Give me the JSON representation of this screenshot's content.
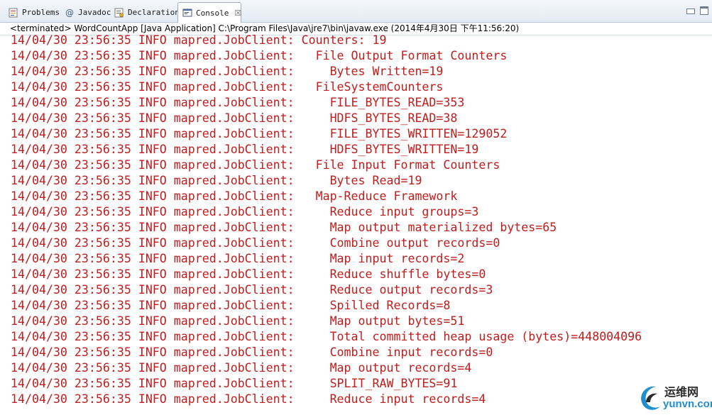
{
  "tabs": [
    {
      "label": "Problems",
      "icon": "problems-icon",
      "active": false
    },
    {
      "label": "Javadoc",
      "icon": "javadoc-at-icon",
      "active": false
    },
    {
      "label": "Declaration",
      "icon": "declaration-icon",
      "active": false
    },
    {
      "label": "Console",
      "icon": "console-icon",
      "active": true,
      "close": "☒"
    }
  ],
  "process_line": "<terminated> WordCountApp [Java Application] C:\\Program Files\\Java\\jre7\\bin\\javaw.exe (2014年4月30日 下午11:56:20)",
  "console_color": "#c01d1d",
  "console_lines": [
    "14/04/30 23:56:35 INFO mapred.JobClient: Counters: 19",
    "14/04/30 23:56:35 INFO mapred.JobClient:   File Output Format Counters",
    "14/04/30 23:56:35 INFO mapred.JobClient:     Bytes Written=19",
    "14/04/30 23:56:35 INFO mapred.JobClient:   FileSystemCounters",
    "14/04/30 23:56:35 INFO mapred.JobClient:     FILE_BYTES_READ=353",
    "14/04/30 23:56:35 INFO mapred.JobClient:     HDFS_BYTES_READ=38",
    "14/04/30 23:56:35 INFO mapred.JobClient:     FILE_BYTES_WRITTEN=129052",
    "14/04/30 23:56:35 INFO mapred.JobClient:     HDFS_BYTES_WRITTEN=19",
    "14/04/30 23:56:35 INFO mapred.JobClient:   File Input Format Counters",
    "14/04/30 23:56:35 INFO mapred.JobClient:     Bytes Read=19",
    "14/04/30 23:56:35 INFO mapred.JobClient:   Map-Reduce Framework",
    "14/04/30 23:56:35 INFO mapred.JobClient:     Reduce input groups=3",
    "14/04/30 23:56:35 INFO mapred.JobClient:     Map output materialized bytes=65",
    "14/04/30 23:56:35 INFO mapred.JobClient:     Combine output records=0",
    "14/04/30 23:56:35 INFO mapred.JobClient:     Map input records=2",
    "14/04/30 23:56:35 INFO mapred.JobClient:     Reduce shuffle bytes=0",
    "14/04/30 23:56:35 INFO mapred.JobClient:     Reduce output records=3",
    "14/04/30 23:56:35 INFO mapred.JobClient:     Spilled Records=8",
    "14/04/30 23:56:35 INFO mapred.JobClient:     Map output bytes=51",
    "14/04/30 23:56:35 INFO mapred.JobClient:     Total committed heap usage (bytes)=448004096",
    "14/04/30 23:56:35 INFO mapred.JobClient:     Combine input records=0",
    "14/04/30 23:56:35 INFO mapred.JobClient:     Map output records=4",
    "14/04/30 23:56:35 INFO mapred.JobClient:     SPLIT_RAW_BYTES=91",
    "14/04/30 23:56:35 INFO mapred.JobClient:     Reduce input records=4"
  ],
  "watermark": {
    "cn": "运维网",
    "en": "yunvn.com",
    "logo_icon": "swirl-logo-icon"
  }
}
